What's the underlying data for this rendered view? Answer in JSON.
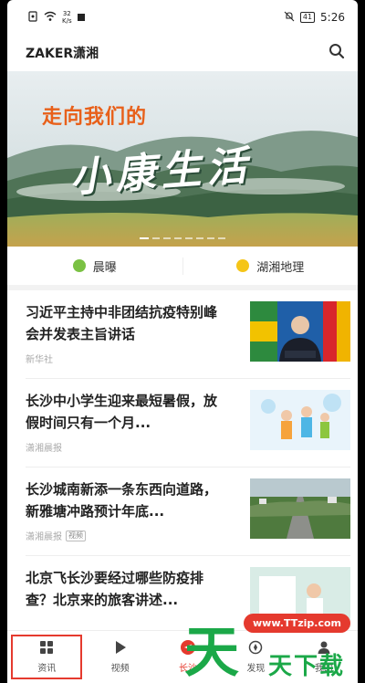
{
  "status": {
    "speed": "32",
    "speed_unit": "K/s",
    "battery": "41",
    "time": "5:26"
  },
  "app": {
    "title": "ZAKER潇湘"
  },
  "banner": {
    "headline": "走向我们的",
    "calligraphy": "小康生活"
  },
  "quicklinks": [
    {
      "label": "晨曝",
      "color": "#7ac143"
    },
    {
      "label": "湖湘地理",
      "color": "#f5c518"
    }
  ],
  "news": [
    {
      "title": "习近平主持中非团结抗疫特别峰会并发表主旨讲话",
      "source": "新华社",
      "tag": ""
    },
    {
      "title": "长沙中小学生迎来最短暑假，放假时间只有一个月...",
      "source": "潇湘晨报",
      "tag": ""
    },
    {
      "title": "长沙城南新添一条东西向道路，新雅塘冲路预计年底...",
      "source": "潇湘晨报",
      "tag": "视频"
    },
    {
      "title": "北京飞长沙要经过哪些防疫排查？北京来的旅客讲述...",
      "source": "",
      "tag": ""
    }
  ],
  "tabs": [
    {
      "label": "资讯",
      "icon": "grid-icon"
    },
    {
      "label": "视频",
      "icon": "play-icon"
    },
    {
      "label": "长沙",
      "icon": "paper-plane-icon"
    },
    {
      "label": "发现",
      "icon": "compass-icon"
    },
    {
      "label": "我的",
      "icon": "person-icon"
    }
  ],
  "watermark": {
    "big": "天",
    "small": "天下载",
    "url": "www.TTzip.com"
  },
  "colors": {
    "accent": "#e53a2e",
    "watermark_green": "#1ba848"
  }
}
